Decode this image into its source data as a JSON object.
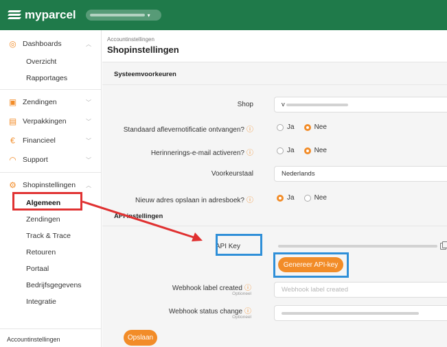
{
  "topbar": {
    "logo_text": "myparcel",
    "shop_selector": "",
    "accent": "#1f7a4a"
  },
  "sidebar": {
    "groups": [
      {
        "label": "Dashboards",
        "icon": "dashboard-icon"
      },
      {
        "label": "Zendingen",
        "icon": "box-icon"
      },
      {
        "label": "Verpakkingen",
        "icon": "package-icon"
      },
      {
        "label": "Financieel",
        "icon": "euro-icon"
      },
      {
        "label": "Support",
        "icon": "headset-icon"
      },
      {
        "label": "Shopinstellingen",
        "icon": "gear-icon"
      }
    ],
    "dashboards_sub": [
      "Overzicht",
      "Rapportages"
    ],
    "shop_sub": [
      "Algemeen",
      "Zendingen",
      "Track & Trace",
      "Retouren",
      "Portaal",
      "Bedrijfsgegevens",
      "Integratie"
    ],
    "footer": "Accountinstellingen"
  },
  "header": {
    "breadcrumb": "Accountinstellingen",
    "title": "Shopinstellingen"
  },
  "system": {
    "title": "Systeemvoorkeuren",
    "shop_label": "Shop",
    "shop_value": "v",
    "notif_label": "Standaard aflevernotificatie ontvangen?",
    "reminder_label": "Herinnerings-e-mail activeren?",
    "lang_label": "Voorkeurstaal",
    "lang_value": "Nederlands",
    "address_label": "Nieuw adres opslaan in adresboek?",
    "yes": "Ja",
    "no": "Nee"
  },
  "api": {
    "title": "API instellingen",
    "key_label": "API Key",
    "generate_button": "Genereer API-key",
    "webhook_label_created": "Webhook label created",
    "webhook_status_change": "Webhook status change",
    "optional": "Optioneel",
    "webhook_created_placeholder": "Webhook label created",
    "webhook_status_value": ""
  },
  "save_button": "Opslaan",
  "colors": {
    "orange": "#f28c28",
    "red_highlight": "#e03131",
    "blue_highlight": "#2f8fd8"
  }
}
